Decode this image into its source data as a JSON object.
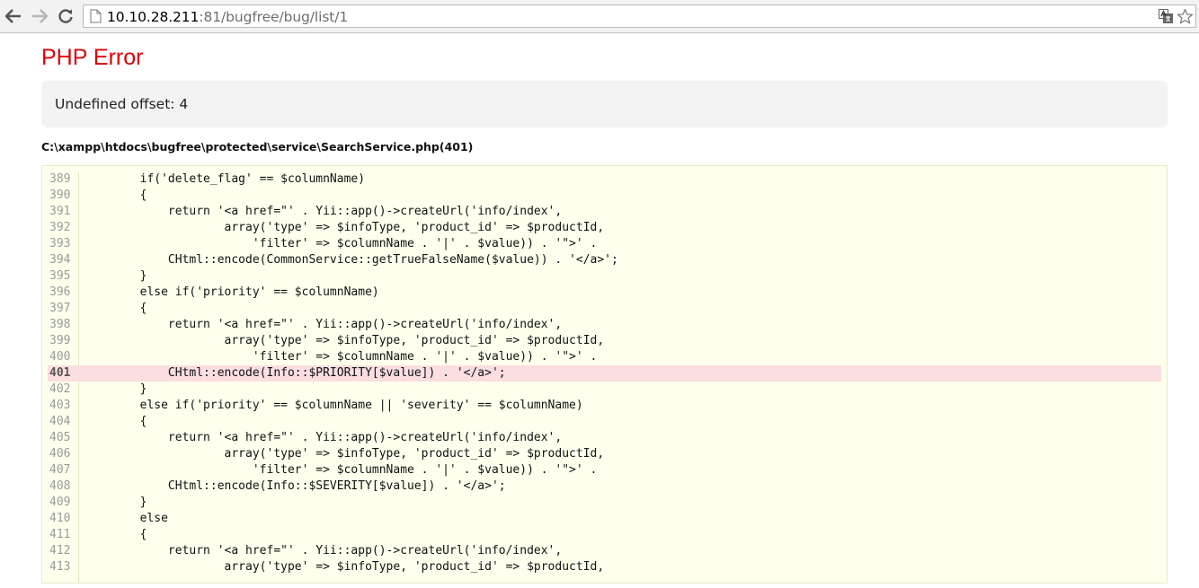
{
  "browser": {
    "url_host": "10.10.28.211",
    "url_rest": ":81/bugfree/bug/list/1"
  },
  "error": {
    "title": "PHP Error",
    "message": "Undefined offset: 4",
    "file": "C:\\xampp\\htdocs\\bugfree\\protected\\service\\SearchService.php(401)"
  },
  "source": {
    "highlight_line": "401",
    "lines": [
      {
        "num": "389",
        "code": "        if('delete_flag' == $columnName)"
      },
      {
        "num": "390",
        "code": "        {"
      },
      {
        "num": "391",
        "code": "            return '<a href=\"' . Yii::app()->createUrl('info/index',"
      },
      {
        "num": "392",
        "code": "                    array('type' => $infoType, 'product_id' => $productId,"
      },
      {
        "num": "393",
        "code": "                        'filter' => $columnName . '|' . $value)) . '\">' ."
      },
      {
        "num": "394",
        "code": "            CHtml::encode(CommonService::getTrueFalseName($value)) . '</a>';"
      },
      {
        "num": "395",
        "code": "        }"
      },
      {
        "num": "396",
        "code": "        else if('priority' == $columnName)"
      },
      {
        "num": "397",
        "code": "        {"
      },
      {
        "num": "398",
        "code": "            return '<a href=\"' . Yii::app()->createUrl('info/index',"
      },
      {
        "num": "399",
        "code": "                    array('type' => $infoType, 'product_id' => $productId,"
      },
      {
        "num": "400",
        "code": "                        'filter' => $columnName . '|' . $value)) . '\">' ."
      },
      {
        "num": "401",
        "code": "            CHtml::encode(Info::$PRIORITY[$value]) . '</a>';"
      },
      {
        "num": "402",
        "code": "        }"
      },
      {
        "num": "403",
        "code": "        else if('priority' == $columnName || 'severity' == $columnName)"
      },
      {
        "num": "404",
        "code": "        {"
      },
      {
        "num": "405",
        "code": "            return '<a href=\"' . Yii::app()->createUrl('info/index',"
      },
      {
        "num": "406",
        "code": "                    array('type' => $infoType, 'product_id' => $productId,"
      },
      {
        "num": "407",
        "code": "                        'filter' => $columnName . '|' . $value)) . '\">' ."
      },
      {
        "num": "408",
        "code": "            CHtml::encode(Info::$SEVERITY[$value]) . '</a>';"
      },
      {
        "num": "409",
        "code": "        }"
      },
      {
        "num": "410",
        "code": "        else"
      },
      {
        "num": "411",
        "code": "        {"
      },
      {
        "num": "412",
        "code": "            return '<a href=\"' . Yii::app()->createUrl('info/index',"
      },
      {
        "num": "413",
        "code": "                    array('type' => $infoType, 'product_id' => $productId,"
      }
    ]
  },
  "icons": {
    "back": "back-arrow-icon",
    "forward": "forward-arrow-icon",
    "reload": "reload-icon",
    "page": "page-icon",
    "translate": "translate-icon",
    "bookmark": "star-icon"
  },
  "colors": {
    "error_title": "#e0000a",
    "code_background": "#ffffee",
    "highlight_background": "#fbdee1",
    "message_background": "#f3f3f3"
  }
}
